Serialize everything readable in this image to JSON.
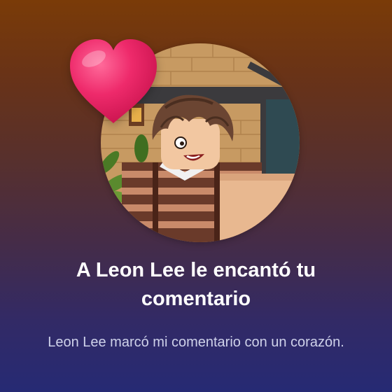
{
  "notification": {
    "title": "A Leon Lee le encantó tu comentario",
    "message": "Leon Lee marcó mi comentario con un corazón.",
    "avatar_icon": "user-avatar-image",
    "badge_icon": "heart-icon"
  },
  "colors": {
    "background_top": "#7a3b08",
    "background_bottom": "#262a74",
    "heart": "#e8175d",
    "title_text": "#ffffff",
    "message_text": "#cfd2ea"
  }
}
